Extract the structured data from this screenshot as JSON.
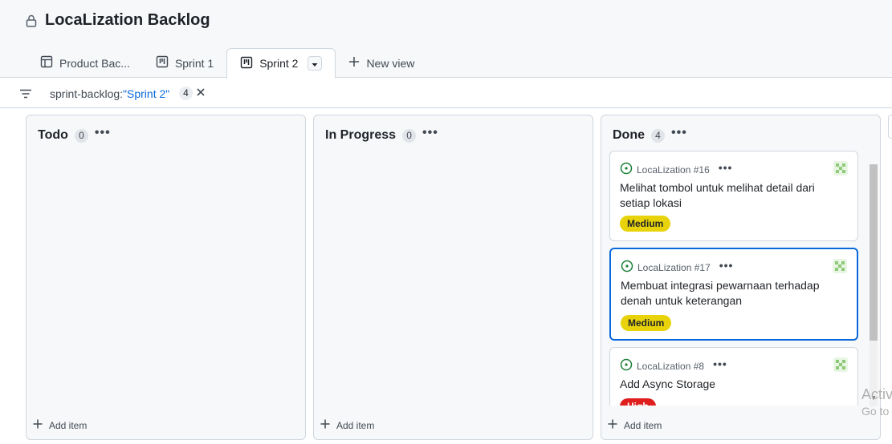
{
  "project": {
    "title": "LocaLization Backlog"
  },
  "tabs": [
    {
      "label": "Product Bac...",
      "icon": "table-icon",
      "active": false
    },
    {
      "label": "Sprint 1",
      "icon": "board-icon",
      "active": false
    },
    {
      "label": "Sprint 2",
      "icon": "board-icon",
      "active": true
    },
    {
      "label": "New view",
      "icon": "plus-icon",
      "active": false
    }
  ],
  "filter": {
    "key": "sprint-backlog:",
    "value": "\"Sprint 2\"",
    "count": "4"
  },
  "columns": [
    {
      "title": "Todo",
      "count": "0",
      "add_label": "Add item"
    },
    {
      "title": "In Progress",
      "count": "0",
      "add_label": "Add item"
    },
    {
      "title": "Done",
      "count": "4",
      "add_label": "Add item"
    }
  ],
  "cards": [
    {
      "ref": "LocaLization #16",
      "title": "Melihat tombol untuk melihat detail dari setiap lokasi",
      "priority": "Medium"
    },
    {
      "ref": "LocaLization #17",
      "title": "Membuat integrasi pewarnaan terhadap denah untuk keterangan",
      "priority": "Medium"
    },
    {
      "ref": "LocaLization #8",
      "title": "Add Async Storage",
      "priority": "High"
    }
  ],
  "colors": {
    "medium": "#e8d30a",
    "high": "#e01e1e",
    "open_issue": "#1a7f37",
    "selected_border": "#0969da"
  },
  "watermark": {
    "line1": "Activ",
    "line2": "Go to"
  }
}
